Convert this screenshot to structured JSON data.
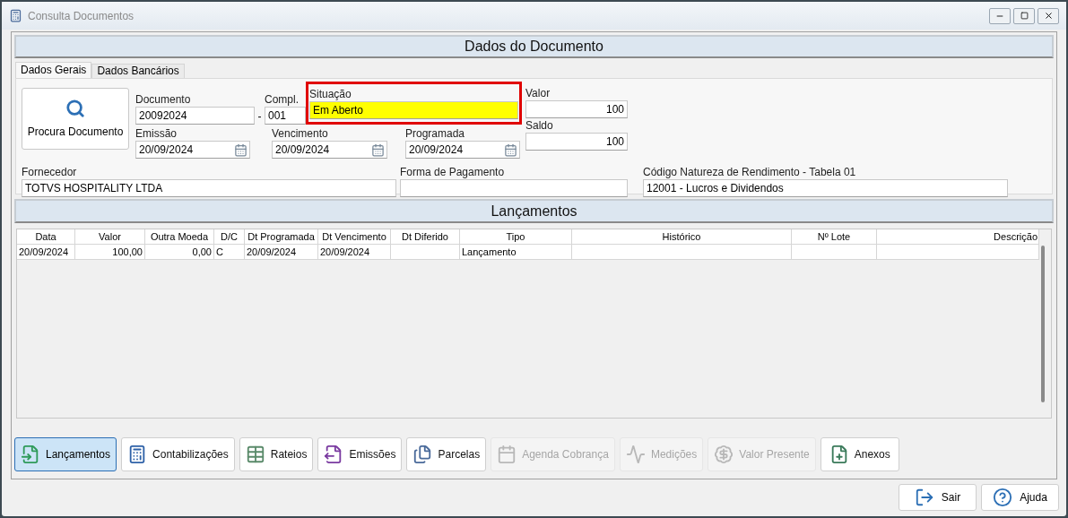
{
  "window": {
    "title": "Consulta Documentos"
  },
  "document_section": {
    "title": "Dados do Documento"
  },
  "tabs": [
    {
      "label": "Dados Gerais",
      "selected": true
    },
    {
      "label": "Dados Bancários",
      "selected": false
    }
  ],
  "search_button": {
    "label": "Procura Documento"
  },
  "documento": {
    "label": "Documento",
    "value": "20092024"
  },
  "separator": "-",
  "compl": {
    "label": "Compl.",
    "value": "001"
  },
  "situacao": {
    "label": "Situação",
    "value": "Em Aberto",
    "highlighted": true
  },
  "valor": {
    "label": "Valor",
    "value": "100"
  },
  "saldo": {
    "label": "Saldo",
    "value": "100"
  },
  "emissao": {
    "label": "Emissão",
    "value": "20/09/2024"
  },
  "vencimento": {
    "label": "Vencimento",
    "value": "20/09/2024"
  },
  "programada": {
    "label": "Programada",
    "value": "20/09/2024"
  },
  "fornecedor": {
    "label": "Fornecedor",
    "value": "TOTVS HOSPITALITY LTDA"
  },
  "forma_pagamento": {
    "label": "Forma de Pagamento"
  },
  "codigo_natureza": {
    "label": "Código Natureza de Rendimento - Tabela 01",
    "value": "12001 - Lucros e Dividendos"
  },
  "entries_section": {
    "title": "Lançamentos"
  },
  "table": {
    "columns": [
      {
        "label": "Data"
      },
      {
        "label": "Valor"
      },
      {
        "label": "Outra Moeda"
      },
      {
        "label": "D/C"
      },
      {
        "label": "Dt Programada"
      },
      {
        "label": "Dt Vencimento"
      },
      {
        "label": "Dt Diferido"
      },
      {
        "label": "Tipo"
      },
      {
        "label": "Histórico"
      },
      {
        "label": "Nº Lote"
      },
      {
        "label": "Descrição"
      }
    ],
    "rows": [
      [
        "20/09/2024",
        "100,00",
        "0,00",
        "C",
        "20/09/2024",
        "20/09/2024",
        "",
        "Lançamento",
        "",
        "",
        ""
      ]
    ]
  },
  "toolbar": [
    {
      "label": "Lançamentos",
      "kind": "entries",
      "selected": true,
      "disabled": false
    },
    {
      "label": "Contabilizações",
      "kind": "accounting",
      "selected": false,
      "disabled": false
    },
    {
      "label": "Rateios",
      "kind": "split",
      "selected": false,
      "disabled": false
    },
    {
      "label": "Emissões",
      "kind": "issue",
      "selected": false,
      "disabled": false
    },
    {
      "label": "Parcelas",
      "kind": "installments",
      "selected": false,
      "disabled": false
    },
    {
      "label": "Agenda Cobrança",
      "kind": "calendar",
      "selected": false,
      "disabled": true
    },
    {
      "label": "Medições",
      "kind": "measure",
      "selected": false,
      "disabled": true
    },
    {
      "label": "Valor Presente",
      "kind": "money",
      "selected": false,
      "disabled": true
    },
    {
      "label": "Anexos",
      "kind": "attach",
      "selected": false,
      "disabled": false
    }
  ],
  "footer_buttons": [
    {
      "label": "Sair",
      "kind": "exit"
    },
    {
      "label": "Ajuda",
      "kind": "help"
    }
  ]
}
